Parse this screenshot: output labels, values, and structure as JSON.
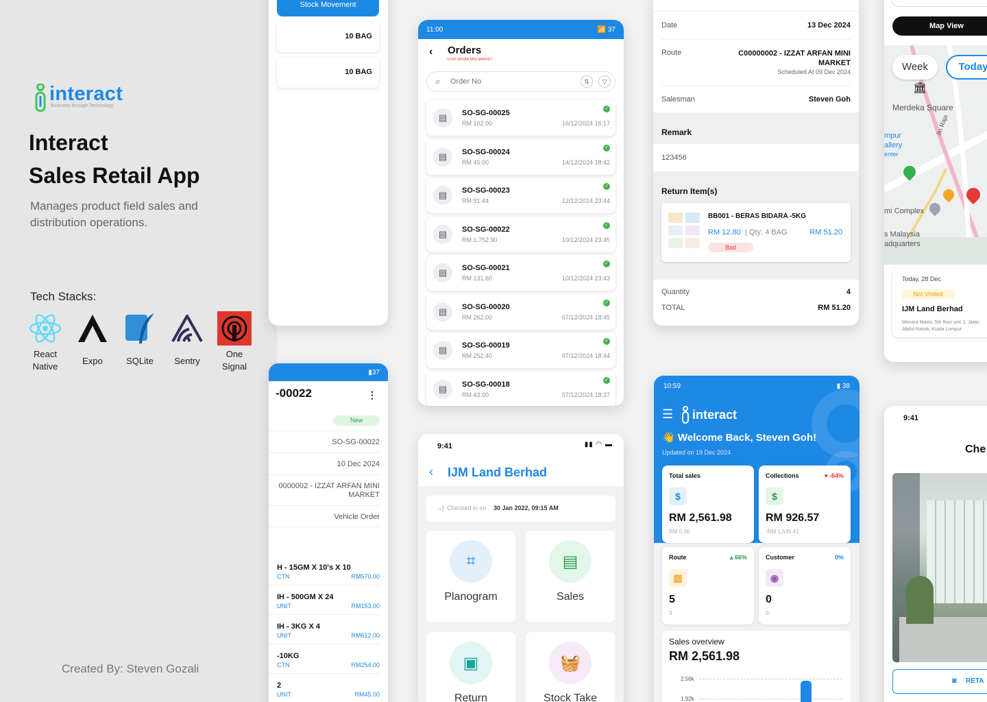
{
  "brand": {
    "name": "interact",
    "tagline": "Business through Technology"
  },
  "hero": {
    "title_line1": "Interact",
    "title_line2": "Sales Retail App",
    "description": "Manages product field sales and distribution operations."
  },
  "tech": {
    "title": "Tech Stacks:",
    "items": [
      {
        "label": "React\nNative",
        "icon": "react-icon"
      },
      {
        "label": "Expo",
        "icon": "expo-icon"
      },
      {
        "label": "SQLite",
        "icon": "sqlite-icon"
      },
      {
        "label": "Sentry",
        "icon": "sentry-icon"
      },
      {
        "label": "One\nSignal",
        "icon": "onesignal-icon"
      }
    ]
  },
  "credit": "Created By: Steven Gozali",
  "stock_card": {
    "tab": "Stock Movement",
    "rows": [
      "10 BAG",
      "10 BAG"
    ]
  },
  "orders_card": {
    "status_time": "11:00",
    "battery": "37",
    "title": "Orders",
    "subtitle": "IZZAT ARFAN MINI MARKET",
    "search_placeholder": "Order No",
    "orders": [
      {
        "no": "SO-SG-00025",
        "amount": "RM 102.00",
        "date": "16/12/2024 16:17"
      },
      {
        "no": "SO-SG-00024",
        "amount": "RM 45.00",
        "date": "14/12/2024 18:42"
      },
      {
        "no": "SO-SG-00023",
        "amount": "RM 91.44",
        "date": "12/12/2024 23:44"
      },
      {
        "no": "SO-SG-00022",
        "amount": "RM 1,752.90",
        "date": "10/12/2024 23:45"
      },
      {
        "no": "SO-SG-00021",
        "amount": "RM 131.60",
        "date": "10/12/2024 23:43"
      },
      {
        "no": "SO-SG-00020",
        "amount": "RM 262.00",
        "date": "07/12/2024 18:45"
      },
      {
        "no": "SO-SG-00019",
        "amount": "RM 252.40",
        "date": "07/12/2024 18:44"
      },
      {
        "no": "SO-SG-00018",
        "amount": "RM 43.00",
        "date": "07/12/2024 18:37"
      }
    ]
  },
  "return_card": {
    "date_label": "Date",
    "date_value": "13 Dec 2024",
    "route_label": "Route",
    "route_value": "C00000002 - IZZAT ARFAN MINI MARKET",
    "route_sched": "Scheduled At 09 Dec 2024",
    "salesman_label": "Salesman",
    "salesman_value": "Steven Goh",
    "remark_title": "Remark",
    "remark_value": "123456",
    "items_title": "Return Item(s)",
    "item": {
      "name": "BB001 - BERAS BIDARA -5KG",
      "price": "RM 12.80",
      "qty": "| Qty: 4 BAG",
      "total": "RM 51.20",
      "tag": "Bad"
    },
    "qty_label": "Quantity",
    "qty_value": "4",
    "total_label": "TOTAL",
    "total_value": "RM 51.20"
  },
  "map_card": {
    "button": "Map View",
    "week": "Week",
    "today": "Today",
    "places": [
      "Merdeka Square",
      "Jln Raja",
      "mpur",
      "allery",
      "enter",
      "mi Complex",
      "s Malaysia",
      "adquarters"
    ],
    "date": "Today, 28 Dec",
    "status": "Not Visited",
    "customer": "IJM Land Berhad",
    "address": "Menara Maxis, 5th floor unit 1, Jalan Abdul Razak, Kuala Lumpur"
  },
  "detail_card": {
    "battery": "37",
    "title": "-00022",
    "status": "New",
    "rows": [
      "SO-SG-00022",
      "10 Dec 2024",
      "0000002 - IZZAT ARFAN MINI MARKET",
      "Vehicle Order"
    ],
    "items": [
      {
        "name": "H - 15GM X 10's X 10",
        "unit": "CTN",
        "price": "RM570.00"
      },
      {
        "name": "IH - 500GM X 24",
        "unit": "UNIT",
        "price": "RM153.00"
      },
      {
        "name": "IH - 3KG X 4",
        "unit": "UNIT",
        "price": "RM612.00"
      },
      {
        "name": "-10KG",
        "unit": "CTN",
        "price": "RM254.00"
      },
      {
        "name": "2",
        "unit": "UNIT",
        "price": "RM45.00"
      }
    ]
  },
  "checkin_card": {
    "time": "9:41",
    "title": "IJM Land Berhad",
    "checked_label": "Checked in on",
    "checked_value": "30 Jan 2022, 09:15 AM",
    "tiles": [
      "Planogram",
      "Sales",
      "Return",
      "Stock Take"
    ]
  },
  "dash_card": {
    "time": "10:59",
    "battery": "38",
    "welcome": "👋 Welcome Back, Steven Goh!",
    "updated": "Updated on 19 Dec 2024",
    "stats": [
      {
        "title": "Total sales",
        "pct": "",
        "value": "RM 2,561.98",
        "sub": "RM 0.00",
        "icon": "$"
      },
      {
        "title": "Collections",
        "pct": "-64%",
        "value": "RM 926.57",
        "sub": "-RM 1,635.41",
        "icon": "$"
      },
      {
        "title": "Route",
        "pct": "66%",
        "value": "5",
        "sub": "3",
        "icon": "store"
      },
      {
        "title": "Customer",
        "pct": "0%",
        "value": "0",
        "sub": "0",
        "icon": "user"
      }
    ],
    "overview_title": "Sales overview",
    "overview_value": "RM 2,561.98",
    "ticks": [
      "2.56k",
      "1.92k"
    ]
  },
  "photo_card": {
    "time": "9:41",
    "title": "Che",
    "button": "RETA"
  },
  "colors": {
    "primary": "#1e88e5",
    "green": "#4caf50",
    "red": "#e53935",
    "orange": "#f5a623"
  }
}
